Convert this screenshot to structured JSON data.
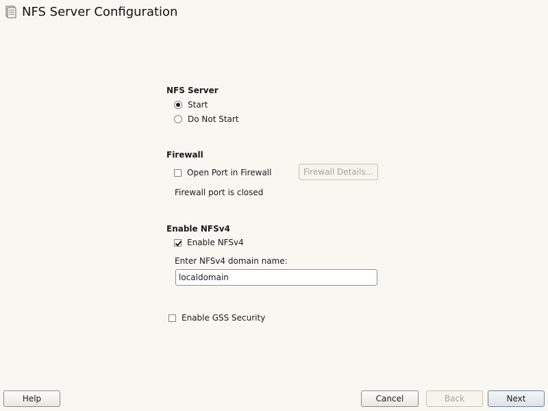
{
  "window": {
    "title": "NFS Server Configuration"
  },
  "nfs_server": {
    "heading": "NFS Server",
    "options": [
      {
        "label": "Start",
        "selected": true
      },
      {
        "label": "Do Not Start",
        "selected": false
      }
    ]
  },
  "firewall": {
    "heading": "Firewall",
    "open_port_label": "Open Port in Firewall",
    "open_port_checked": false,
    "details_button": "Firewall Details...",
    "status": "Firewall port is closed"
  },
  "nfsv4": {
    "heading": "Enable NFSv4",
    "enable_label": "Enable NFSv4",
    "enable_checked": true,
    "domain_label": "Enter NFSv4 domain name:",
    "domain_value": "localdomain"
  },
  "gss": {
    "label": "Enable GSS Security",
    "checked": false
  },
  "buttons": {
    "help": "Help",
    "cancel": "Cancel",
    "back": "Back",
    "next": "Next"
  }
}
